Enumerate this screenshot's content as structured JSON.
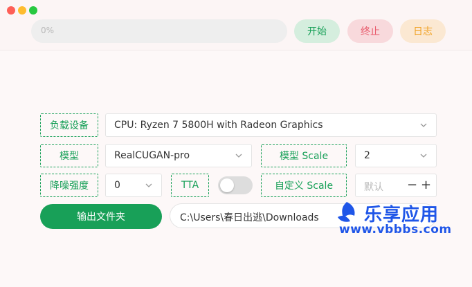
{
  "progress": {
    "label": "0%",
    "value": 0
  },
  "toolbar": {
    "start_label": "开始",
    "stop_label": "终止",
    "log_label": "日志"
  },
  "form": {
    "device": {
      "label": "负载设备",
      "value": "CPU: Ryzen 7 5800H with Radeon Graphics"
    },
    "model": {
      "label": "模型",
      "value": "RealCUGAN-pro"
    },
    "model_scale": {
      "label": "模型 Scale",
      "value": "2"
    },
    "denoise": {
      "label": "降噪强度",
      "value": "0"
    },
    "tta": {
      "label": "TTA",
      "enabled": false
    },
    "custom_scale": {
      "label": "自定义 Scale",
      "placeholder": "默认",
      "minus": "−",
      "plus": "+"
    },
    "output": {
      "button_label": "输出文件夹",
      "path": "C:\\Users\\春日出逃\\Downloads"
    }
  },
  "watermark": {
    "title": "乐享应用",
    "url": "www.vbbbs.com"
  },
  "colors": {
    "accent": "#18a058",
    "danger": "#e85a6b",
    "warning": "#f0a020",
    "watermark": "#1f56e8"
  }
}
